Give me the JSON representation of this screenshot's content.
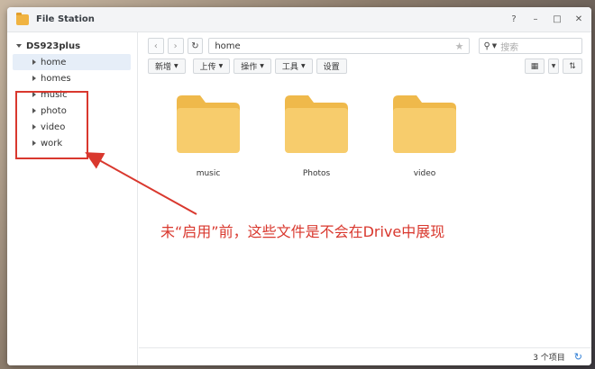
{
  "window": {
    "title": "File Station",
    "controls": [
      "?",
      "–",
      "□",
      "✕"
    ]
  },
  "sidebar": {
    "root": "DS923plus",
    "items": [
      {
        "label": "home",
        "selected": true
      },
      {
        "label": "homes",
        "selected": false
      },
      {
        "label": "music",
        "selected": false
      },
      {
        "label": "photo",
        "selected": false
      },
      {
        "label": "video",
        "selected": false
      },
      {
        "label": "work",
        "selected": false
      }
    ]
  },
  "navbar": {
    "back": "‹",
    "forward": "›",
    "refresh": "↻",
    "path": "home",
    "star": "★",
    "search_placeholder": "搜索"
  },
  "toolbar": {
    "create": "新增",
    "upload": "上传",
    "action": "操作",
    "tools": "工具",
    "settings": "设置"
  },
  "files": [
    {
      "name": "music"
    },
    {
      "name": "Photos"
    },
    {
      "name": "video"
    }
  ],
  "status": {
    "count": "3 个项目",
    "refresh": "↻"
  },
  "annotation": {
    "text": "未“启用”前，这些文件是不会在Drive中展现"
  },
  "colors": {
    "folder": "#f7cc6c",
    "folder_tab": "#efb94b",
    "annotation": "#d9382e",
    "selected_bg": "#e6eef8"
  }
}
